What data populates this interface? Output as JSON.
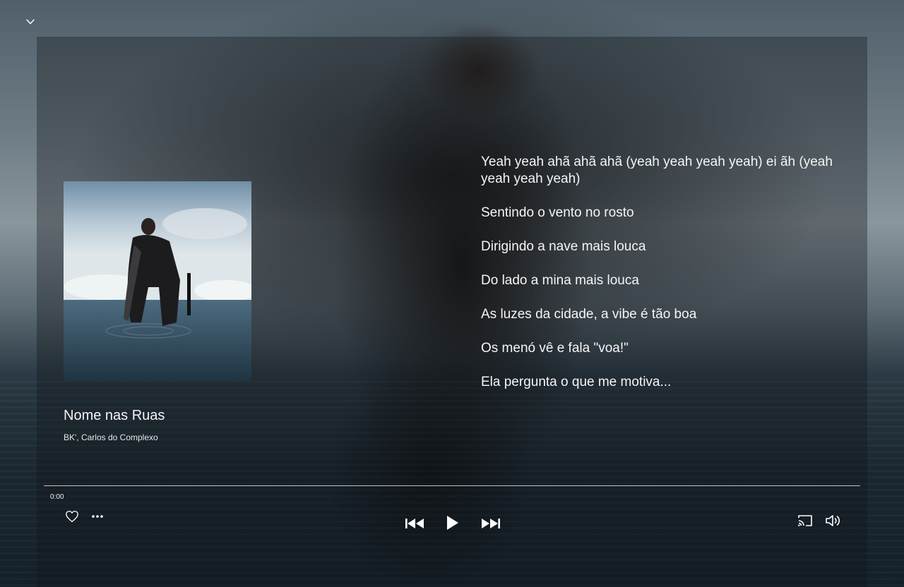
{
  "song": {
    "title": "Nome nas Ruas",
    "artists": "BK', Carlos do Complexo"
  },
  "lyrics": [
    "Yeah yeah ahã ahã ahã (yeah yeah yeah yeah) ei ãh (yeah yeah yeah yeah)",
    "Sentindo o vento no rosto",
    "Dirigindo a nave mais louca",
    "Do lado a mina mais louca",
    "As luzes da cidade, a vibe é tão boa",
    "Os menó vê e fala \"voa!\"",
    "Ela pergunta o que me motiva..."
  ],
  "player": {
    "current_time": "0:00",
    "progress_fraction": 0.0
  },
  "icons": {
    "collapse": "chevron-down-icon",
    "like": "heart-icon",
    "more": "more-dots-icon",
    "previous": "skip-previous-icon",
    "play": "play-icon",
    "next": "skip-next-icon",
    "cast": "cast-icon",
    "volume": "volume-icon"
  },
  "colors": {
    "text": "#ffffff",
    "panel_overlay": "rgba(18,20,24,0.35)"
  }
}
